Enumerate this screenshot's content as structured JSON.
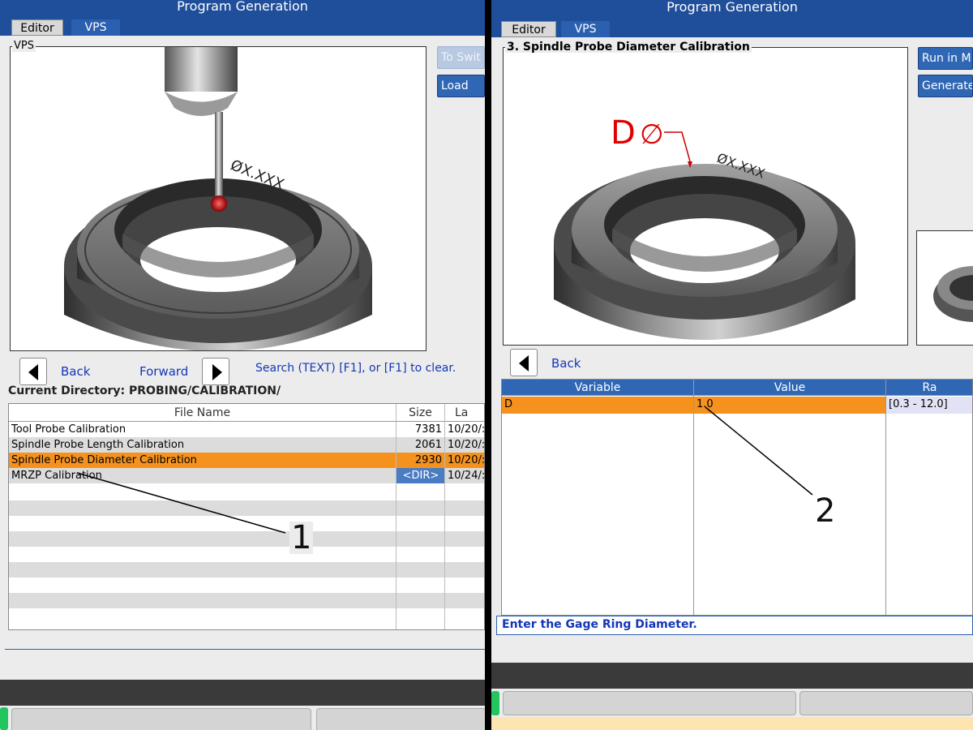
{
  "left": {
    "title": "Program Generation",
    "tabs": [
      {
        "label": "Editor"
      },
      {
        "label": "VPS"
      }
    ],
    "panel_legend": "VPS",
    "side_buttons": [
      {
        "label": "To Swit"
      },
      {
        "label": "Load"
      }
    ],
    "image_engraving": "ØX.XXX",
    "nav": {
      "back": "Back",
      "forward": "Forward",
      "search_hint": "Search (TEXT) [F1], or [F1] to clear."
    },
    "current_directory_label": "Current Directory: PROBING/CALIBRATION/",
    "table": {
      "headers": [
        "File Name",
        "Size",
        "La"
      ],
      "rows": [
        {
          "name": "Tool Probe Calibration",
          "size": "7381",
          "date": "10/20/:",
          "selected": false,
          "dir": false
        },
        {
          "name": "Spindle Probe Length Calibration",
          "size": "2061",
          "date": "10/20/:",
          "selected": false,
          "dir": false
        },
        {
          "name": "Spindle Probe Diameter Calibration",
          "size": "2930",
          "date": "10/20/:",
          "selected": true,
          "dir": false
        },
        {
          "name": "MRZP Calibration",
          "size": "<DIR>",
          "date": "10/24/:",
          "selected": false,
          "dir": true
        }
      ]
    },
    "callout": "1"
  },
  "right": {
    "title": "Program Generation",
    "tabs": [
      {
        "label": "Editor"
      },
      {
        "label": "VPS"
      }
    ],
    "panel_legend": "3. Spindle Probe Diameter Calibration",
    "side_buttons": [
      {
        "label": "Run in MI"
      },
      {
        "label": "Generate"
      }
    ],
    "image_label_d": "D",
    "image_label_phi": "∅",
    "image_engraving": "ØX.XXX",
    "nav": {
      "back": "Back"
    },
    "table": {
      "headers": [
        "Variable",
        "Value",
        "Ra"
      ],
      "rows": [
        {
          "variable": "D",
          "value": "1.0",
          "range": "[0.3 - 12.0]"
        }
      ]
    },
    "prompt": "Enter the Gage Ring Diameter.",
    "callout": "2"
  },
  "colors": {
    "title_bar": "#1f4e9a",
    "selected_row": "#f5921e",
    "button": "#2f67b5",
    "link": "#1336b8",
    "status_indicator": "#22c55e",
    "footer": "#fde4b0"
  }
}
